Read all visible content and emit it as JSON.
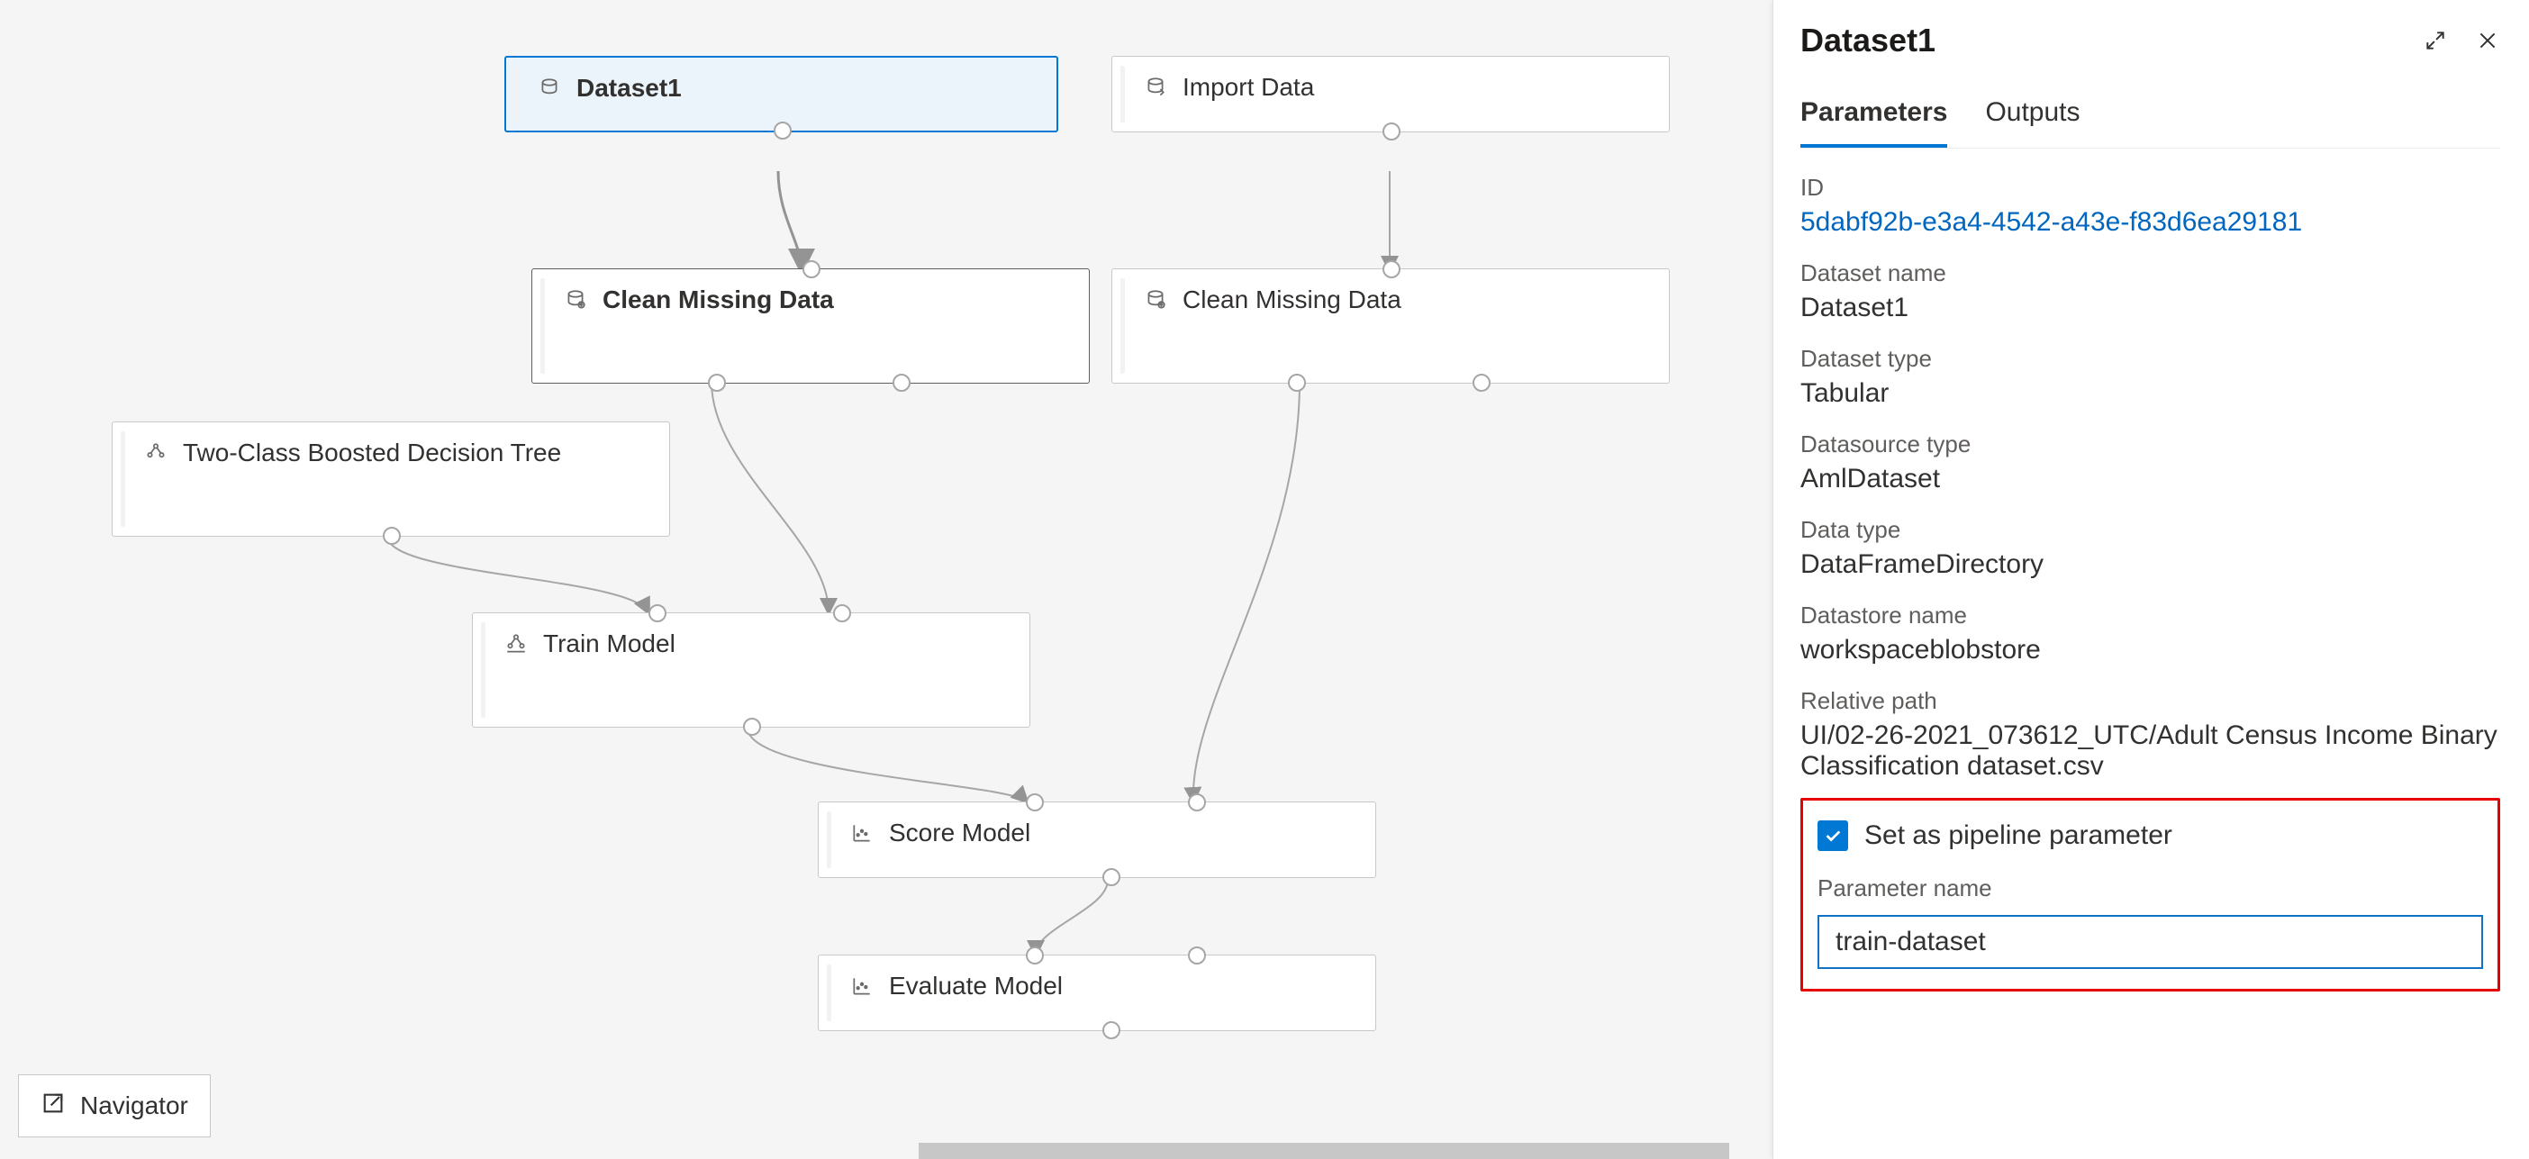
{
  "canvas": {
    "nodes": {
      "dataset1": {
        "label": "Dataset1"
      },
      "importData": {
        "label": "Import Data"
      },
      "cleanMissing1": {
        "label": "Clean Missing Data"
      },
      "cleanMissing2": {
        "label": "Clean Missing Data"
      },
      "twoClass": {
        "label": "Two-Class Boosted Decision Tree"
      },
      "trainModel": {
        "label": "Train Model"
      },
      "scoreModel": {
        "label": "Score Model"
      },
      "evaluateModel": {
        "label": "Evaluate Model"
      }
    }
  },
  "navigator": {
    "label": "Navigator"
  },
  "panel": {
    "title": "Dataset1",
    "tabs": {
      "parameters": "Parameters",
      "outputs": "Outputs"
    },
    "fields": [
      {
        "label": "ID",
        "value": "5dabf92b-e3a4-4542-a43e-f83d6ea29181",
        "link": true
      },
      {
        "label": "Dataset name",
        "value": "Dataset1"
      },
      {
        "label": "Dataset type",
        "value": "Tabular"
      },
      {
        "label": "Datasource type",
        "value": "AmlDataset"
      },
      {
        "label": "Data type",
        "value": "DataFrameDirectory"
      },
      {
        "label": "Datastore name",
        "value": "workspaceblobstore"
      },
      {
        "label": "Relative path",
        "value": "UI/02-26-2021_073612_UTC/Adult Census Income Binary Classification dataset.csv"
      }
    ],
    "pipelineParam": {
      "checkboxLabel": "Set as pipeline parameter",
      "paramNameLabel": "Parameter name",
      "paramNameValue": "train-dataset"
    }
  }
}
